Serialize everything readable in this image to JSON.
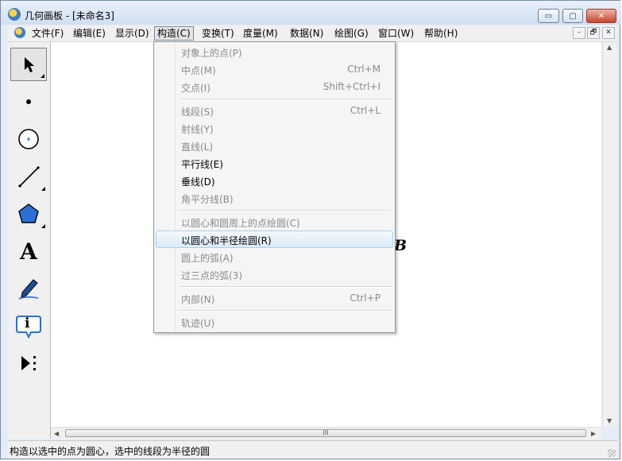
{
  "window": {
    "title": "几何画板 - [未命名3]",
    "controls": {
      "minimize": "▭",
      "maximize": "▢",
      "close": "✕"
    }
  },
  "menubar": {
    "items": [
      "文件(F)",
      "编辑(E)",
      "显示(D)",
      "构造(C)",
      "变换(T)",
      "度量(M)",
      "数据(N)",
      "绘图(G)",
      "窗口(W)",
      "帮助(H)"
    ],
    "active": "构造(C)",
    "mdi_controls": {
      "minimize": "–",
      "restore": "🗗",
      "close": "✕"
    }
  },
  "construct_menu": {
    "items": [
      {
        "label": "对象上的点(P)",
        "shortcut": "",
        "enabled": false
      },
      {
        "label": "中点(M)",
        "shortcut": "Ctrl+M",
        "enabled": false
      },
      {
        "label": "交点(I)",
        "shortcut": "Shift+Ctrl+I",
        "enabled": false
      },
      {
        "label": "线段(S)",
        "shortcut": "Ctrl+L",
        "enabled": false
      },
      {
        "label": "射线(Y)",
        "shortcut": "",
        "enabled": false
      },
      {
        "label": "直线(L)",
        "shortcut": "",
        "enabled": false
      },
      {
        "label": "平行线(E)",
        "shortcut": "",
        "enabled": true
      },
      {
        "label": "垂线(D)",
        "shortcut": "",
        "enabled": true
      },
      {
        "label": "角平分线(B)",
        "shortcut": "",
        "enabled": false
      },
      {
        "label": "以圆心和圆周上的点绘圆(C)",
        "shortcut": "",
        "enabled": false
      },
      {
        "label": "以圆心和半径绘圆(R)",
        "shortcut": "",
        "enabled": true,
        "highlighted": true
      },
      {
        "label": "圆上的弧(A)",
        "shortcut": "",
        "enabled": false
      },
      {
        "label": "过三点的弧(3)",
        "shortcut": "",
        "enabled": false
      },
      {
        "label": "内部(N)",
        "shortcut": "Ctrl+P",
        "enabled": false
      },
      {
        "label": "轨迹(U)",
        "shortcut": "",
        "enabled": false
      }
    ]
  },
  "toolbox": {
    "tools": [
      "arrow-select-tool",
      "point-tool",
      "compass-tool",
      "straightedge-tool",
      "polygon-tool",
      "text-tool",
      "marker-tool",
      "information-tool",
      "custom-tool"
    ],
    "text_tool_glyph": "A",
    "info_tool_glyph": "i"
  },
  "canvas": {
    "point_label": "B"
  },
  "scrollbars": {
    "h_thumb_grip": "III"
  },
  "statusbar": {
    "text": "构造以选中的点为圆心，选中的线段为半径的圆"
  },
  "colors": {
    "accent": "#3399ff",
    "titlebar": "#cfdff1",
    "menu_highlight": "#dbeaf8",
    "marker_blue": "#2b6fd6"
  }
}
